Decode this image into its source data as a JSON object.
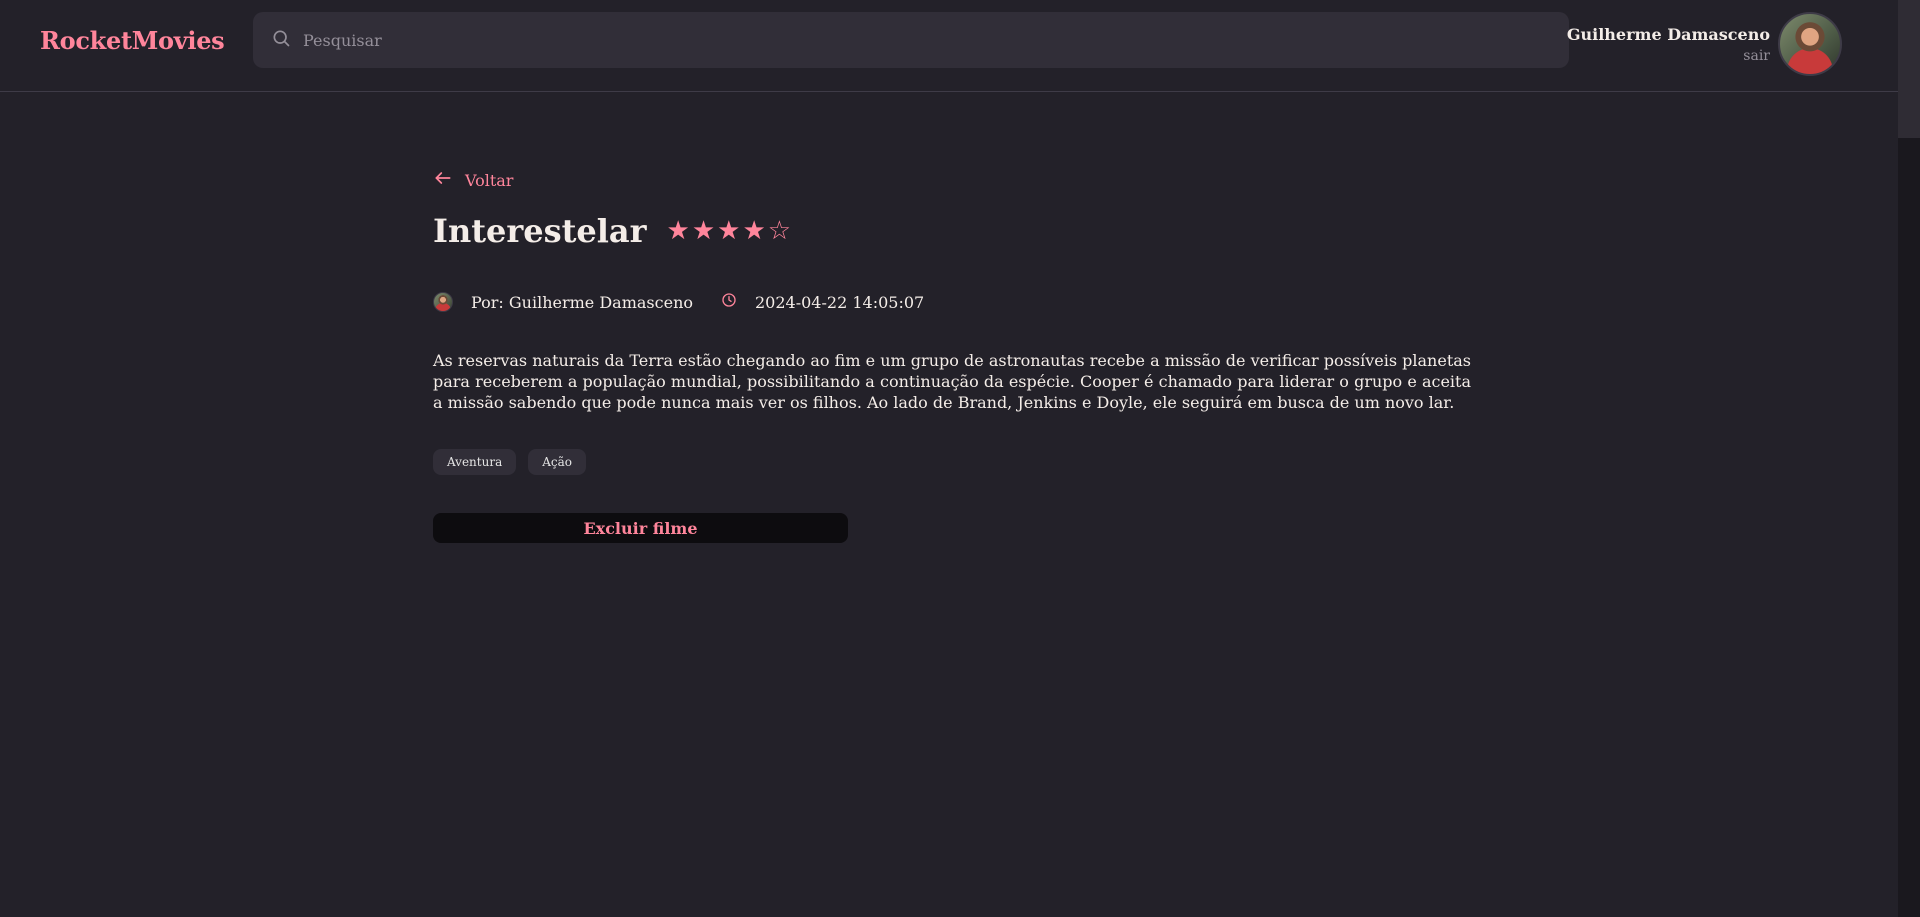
{
  "header": {
    "brand": "RocketMovies",
    "search_placeholder": "Pesquisar",
    "user_name": "Guilherme Damasceno",
    "logout_label": "sair"
  },
  "movie": {
    "back_label": "Voltar",
    "title": "Interestelar",
    "rating": 4,
    "rating_max": 5,
    "stars": [
      "★",
      "★",
      "★",
      "★",
      "☆"
    ],
    "author": "Por: Guilherme Damasceno",
    "datetime": "2024-04-22 14:05:07",
    "synopsis": "As reservas naturais da Terra estão chegando ao fim e um grupo de astronautas recebe a missão de verificar possíveis planetas para receberem a população mundial, possibilitando a continuação da espécie. Cooper é chamado para liderar o grupo e aceita a missão sabendo que pode nunca mais ver os filhos. Ao lado de Brand, Jenkins e Doyle, ele seguirá em busca de um novo lar.",
    "tags": [
      "Aventura",
      "Ação"
    ],
    "delete_label": "Excluir filme"
  },
  "colors": {
    "accent": "#FF859B",
    "background": "#232129",
    "surface": "#312E38",
    "text": "#F4EDE8",
    "muted": "#948F99"
  },
  "icons": {
    "search": "search-icon",
    "back": "arrow-left-icon",
    "clock": "clock-icon"
  }
}
